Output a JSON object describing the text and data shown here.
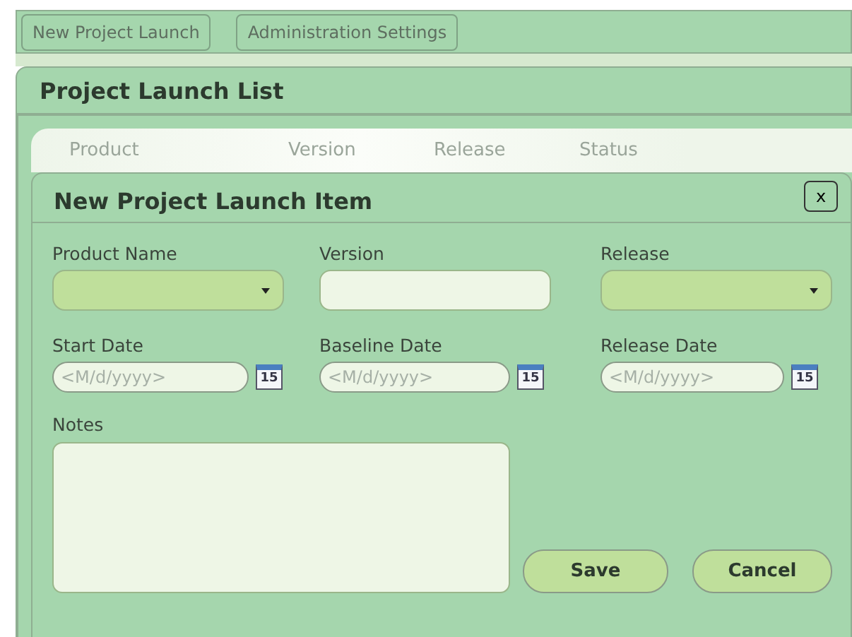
{
  "toolbar": {
    "buttons": [
      "New Project Launch",
      "Administration Settings"
    ]
  },
  "panel": {
    "title": "Project Launch List",
    "columns": [
      "Product",
      "Version",
      "Release",
      "Status"
    ]
  },
  "dialog": {
    "title": "New Project Launch Item",
    "close": "x",
    "rows": [
      [
        {
          "kind": "dropdown",
          "label": "Product Name"
        },
        {
          "kind": "text",
          "label": "Version"
        },
        {
          "kind": "dropdown",
          "label": "Release"
        }
      ],
      [
        {
          "kind": "date",
          "label": "Start Date",
          "placeholder": "<M/d/yyyy>",
          "calendar_day": "15"
        },
        {
          "kind": "date",
          "label": "Baseline Date",
          "placeholder": "<M/d/yyyy>",
          "calendar_day": "15"
        },
        {
          "kind": "date",
          "label": "Release Date",
          "placeholder": "<M/d/yyyy>",
          "calendar_day": "15"
        }
      ]
    ],
    "notes_label": "Notes",
    "buttons": [
      "Save",
      "Cancel"
    ]
  }
}
